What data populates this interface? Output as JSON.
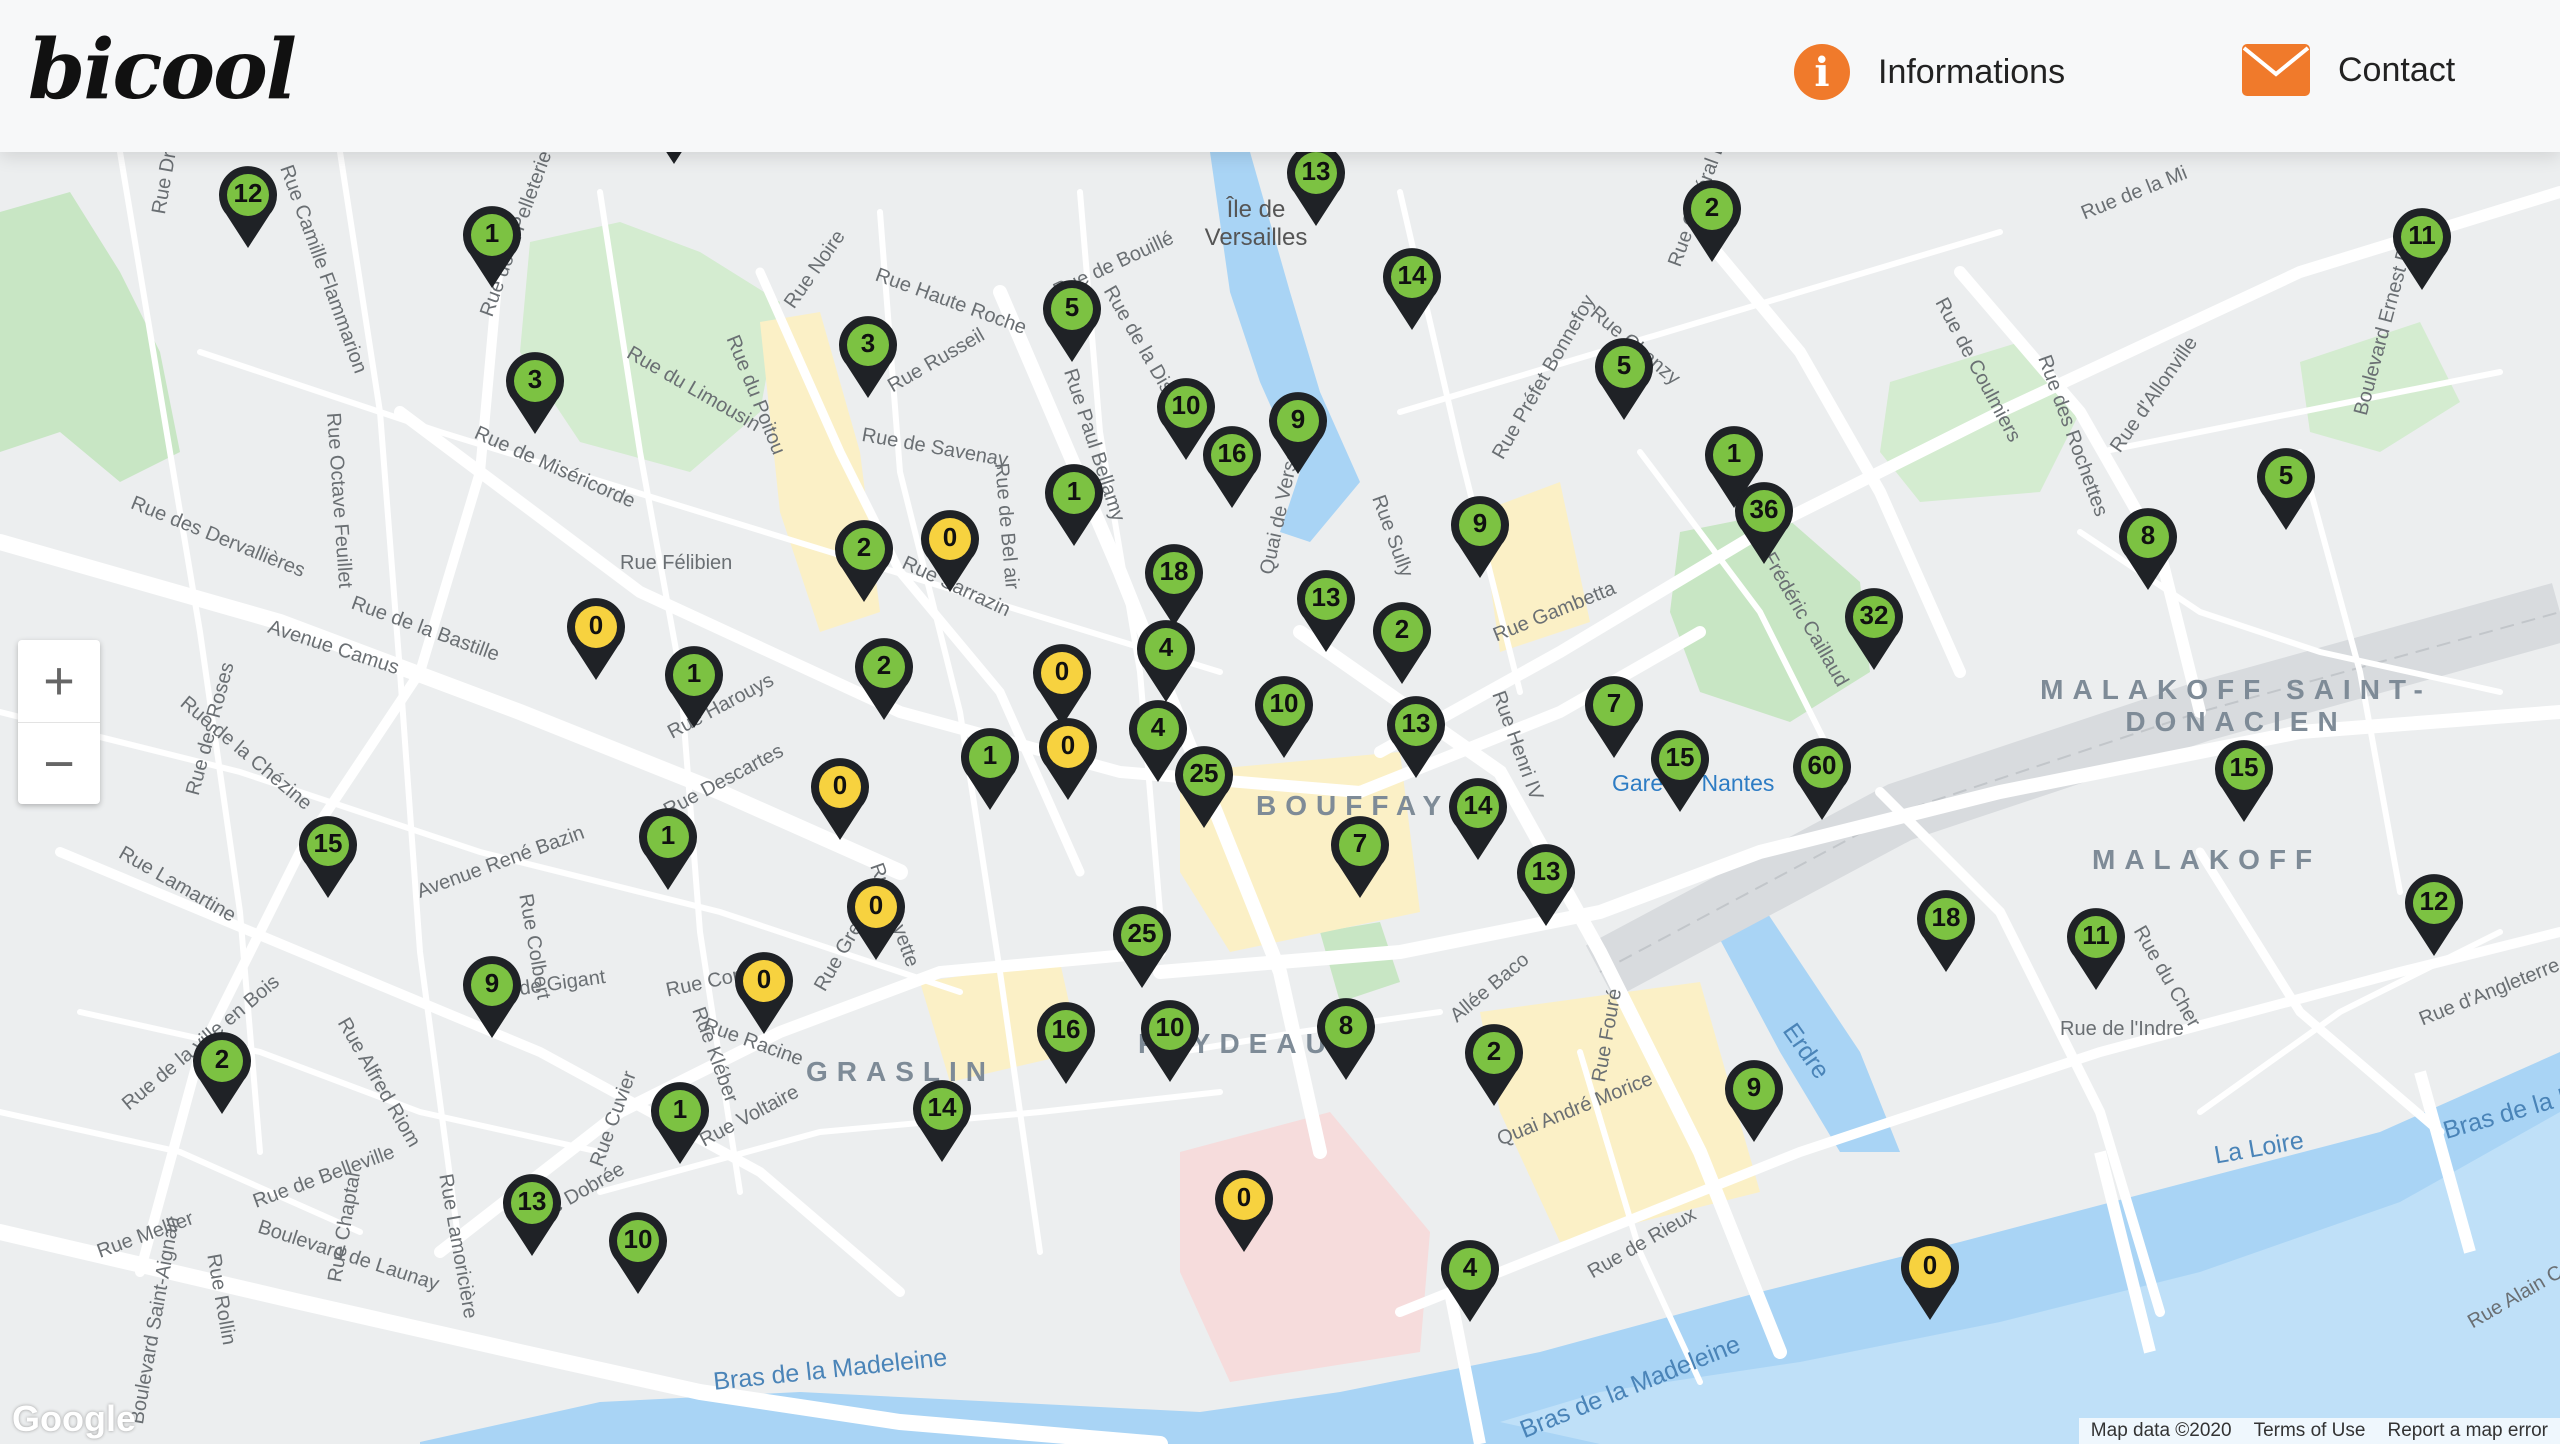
{
  "header": {
    "logo": "bicool",
    "nav": [
      {
        "label": "Informations",
        "icon": "info-icon"
      },
      {
        "label": "Contact",
        "icon": "envelope-icon"
      }
    ]
  },
  "colors": {
    "available": "#7cc242",
    "empty": "#f7d23f",
    "pin_outline": "#1f2226",
    "accent": "#f07a2b"
  },
  "map": {
    "zoom_in": "+",
    "zoom_out": "−",
    "google_logo": "Google",
    "attribution": [
      "Map data ©2020",
      "Terms of Use",
      "Report a map error"
    ],
    "districts": [
      "BOUFFAY",
      "FEYDEAU",
      "GRASLIN",
      "MALAKOFF SAINT-DONACIEN",
      "MALAKOFF"
    ],
    "places": [
      "Île de Versailles",
      "Gare de Nantes"
    ],
    "water": [
      "La Loire",
      "Bras de la Madeleine",
      "Bras de la Madeleine",
      "Erdre",
      "Bras de la M"
    ],
    "streets": [
      "Rue Félibien",
      "Rue des Dervallières",
      "Rue de la Bastille",
      "Avenue Camus",
      "Rue Descartes",
      "Rue Copernic",
      "Rue de Gigant",
      "Rue Paul Bellamy",
      "Rue Gambetta",
      "Rue de Coulmiers",
      "Rue Général Buat",
      "Rue Henri IV",
      "Rue Sully",
      "Boulevard de Launay",
      "Quai André Morice",
      "Quai de Versailles",
      "Rue du Poitou",
      "Rue de Savenay",
      "Boulevard Ernest Dalby",
      "Rue Frédéric Caillaud",
      "Rue Harouys",
      "Rue Voltaire",
      "Rue Racine",
      "Rue Kléber",
      "Rue Dobrée",
      "Rue de Belleville",
      "Rue Mellier",
      "Allée Baco",
      "Rue Fouré",
      "Rue de Rieux",
      "Rue de l'Indre",
      "Rue du Cher",
      "Rue de Bel air",
      "Rue Sarrazin",
      "Rue Noire",
      "Rue de la Distillerie",
      "Rue Haute Roche",
      "Rue Russeil",
      "Rue du Limousin",
      "Rue de Miséricorde",
      "Avenue René Bazin",
      "Rue Colbert",
      "Rue Lamartine",
      "Rue des Roses",
      "Rue de la Chézine",
      "Rue Camille Flammarion",
      "Rue Octave Feuillet",
      "Rue Dr Guépin",
      "Rue de la Pelleterie",
      "Rue Alfred Riom",
      "Rue de la ville en Bois",
      "Rue Cuvier",
      "Rue Lamoricière",
      "Rue Chaptal",
      "Rue Rollin",
      "Boulevard Saint-Aignan",
      "Rue d'Angleterre",
      "Rue Alain Colas",
      "Rue des Rochettes",
      "Rue d'Allonville",
      "Rue Préfet Bonnefoy",
      "Rue Chanzy",
      "Rue de Bouillé",
      "Rue Gresset",
      "Rue Fayette",
      "Rue de la Mi"
    ]
  },
  "stations": [
    {
      "bikes": "8"
    },
    {
      "bikes": "5"
    },
    {
      "bikes": "12"
    },
    {
      "bikes": "1"
    },
    {
      "bikes": "3"
    },
    {
      "bikes": "5"
    },
    {
      "bikes": "3"
    },
    {
      "bikes": "13"
    },
    {
      "bikes": "9"
    },
    {
      "bikes": "2"
    },
    {
      "bikes": "11"
    },
    {
      "bikes": "14"
    },
    {
      "bikes": "10"
    },
    {
      "bikes": "16"
    },
    {
      "bikes": "9"
    },
    {
      "bikes": "5"
    },
    {
      "bikes": "1"
    },
    {
      "bikes": "2"
    },
    {
      "bikes": "0"
    },
    {
      "bikes": "0"
    },
    {
      "bikes": "1"
    },
    {
      "bikes": "18"
    },
    {
      "bikes": "13"
    },
    {
      "bikes": "9"
    },
    {
      "bikes": "1"
    },
    {
      "bikes": "36"
    },
    {
      "bikes": "5"
    },
    {
      "bikes": "8"
    },
    {
      "bikes": "32"
    },
    {
      "bikes": "2"
    },
    {
      "bikes": "4"
    },
    {
      "bikes": "2"
    },
    {
      "bikes": "0"
    },
    {
      "bikes": "10"
    },
    {
      "bikes": "13"
    },
    {
      "bikes": "7"
    },
    {
      "bikes": "4"
    },
    {
      "bikes": "0"
    },
    {
      "bikes": "1"
    },
    {
      "bikes": "25"
    },
    {
      "bikes": "15"
    },
    {
      "bikes": "60"
    },
    {
      "bikes": "15"
    },
    {
      "bikes": "0"
    },
    {
      "bikes": "1"
    },
    {
      "bikes": "15"
    },
    {
      "bikes": "14"
    },
    {
      "bikes": "7"
    },
    {
      "bikes": "13"
    },
    {
      "bikes": "12"
    },
    {
      "bikes": "18"
    },
    {
      "bikes": "11"
    },
    {
      "bikes": "0"
    },
    {
      "bikes": "25"
    },
    {
      "bikes": "0"
    },
    {
      "bikes": "9"
    },
    {
      "bikes": "16"
    },
    {
      "bikes": "8"
    },
    {
      "bikes": "10"
    },
    {
      "bikes": "2"
    },
    {
      "bikes": "14"
    },
    {
      "bikes": "2"
    },
    {
      "bikes": "9"
    },
    {
      "bikes": "1"
    },
    {
      "bikes": "13"
    },
    {
      "bikes": "10"
    },
    {
      "bikes": "0"
    },
    {
      "bikes": "4"
    },
    {
      "bikes": "0"
    }
  ]
}
